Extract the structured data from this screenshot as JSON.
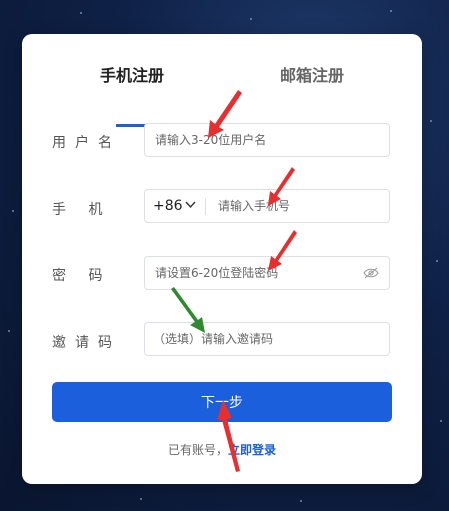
{
  "tabs": {
    "phone_register": "手机注册",
    "email_register": "邮箱注册"
  },
  "form": {
    "username": {
      "label": "用户名",
      "placeholder": "请输入3-20位用户名"
    },
    "phone": {
      "label": "手 机",
      "prefix": "+86",
      "placeholder": "请输入手机号"
    },
    "password": {
      "label": "密 码",
      "placeholder": "请设置6-20位登陆密码"
    },
    "invite": {
      "label": "邀请码",
      "placeholder": "（选填）请输入邀请码"
    }
  },
  "actions": {
    "next_label": "下一步"
  },
  "footer": {
    "prompt": "已有账号，",
    "login_link": "立即登录"
  },
  "colors": {
    "accent": "#1b5fdc",
    "red_arrow": "#e82f2f",
    "green_arrow": "#2f8a2f"
  },
  "icons": {
    "dropdown": "chevron-down-icon",
    "visibility": "eye-off-icon"
  }
}
